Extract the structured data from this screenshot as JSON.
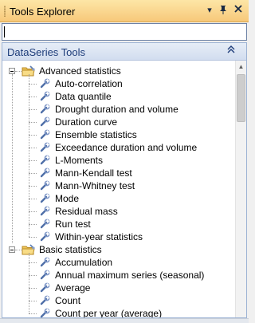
{
  "window": {
    "title": "Tools Explorer",
    "buttons": {
      "dropdown": "▾",
      "pin": "📌",
      "close": "✕"
    },
    "accent": "#f7c87a"
  },
  "search": {
    "value": "",
    "placeholder": ""
  },
  "panel": {
    "title": "DataSeries Tools",
    "collapse_glyph": "⌃⌃",
    "title_color": "#1e3d7a"
  },
  "tree": {
    "groups": [
      {
        "label": "Advanced statistics",
        "icon": "folder-icon",
        "expanded": true,
        "items": [
          "Auto-correlation",
          "Data quantile",
          "Drought duration and volume",
          "Duration curve",
          "Ensemble statistics",
          "Exceedance duration and volume",
          "L-Moments",
          "Mann-Kendall test",
          "Mann-Whitney test",
          "Mode",
          "Residual mass",
          "Run test",
          "Within-year statistics"
        ]
      },
      {
        "label": "Basic statistics",
        "icon": "folder-icon",
        "expanded": true,
        "items": [
          "Accumulation",
          "Annual maximum series (seasonal)",
          "Average",
          "Count",
          "Count per year (average)"
        ]
      }
    ],
    "item_icon": "wrench-icon"
  }
}
